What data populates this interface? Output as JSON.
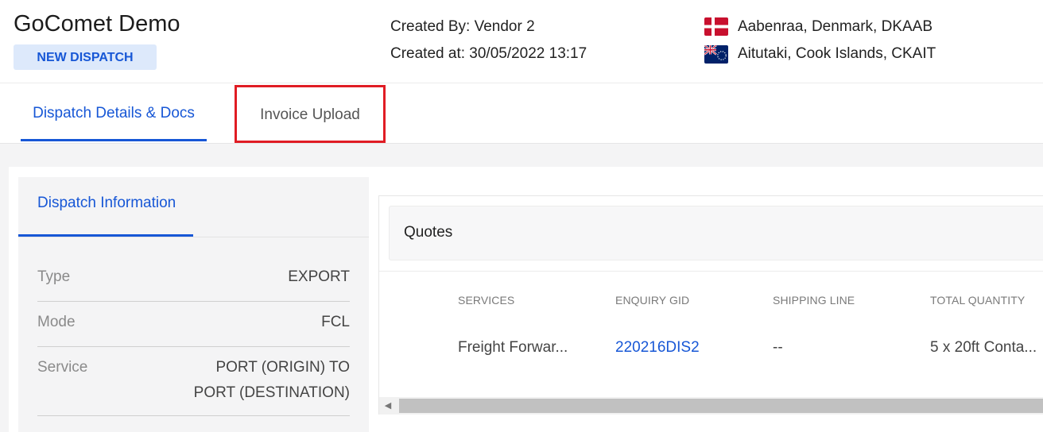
{
  "header": {
    "title": "GoComet Demo",
    "badge": "NEW DISPATCH",
    "created_by": "Created By: Vendor 2",
    "created_at": "Created at: 30/05/2022 13:17",
    "origin": {
      "label": "Aabenraa, Denmark, DKAAB",
      "flag_icon": "denmark-flag-icon"
    },
    "destination": {
      "label": "Aitutaki, Cook Islands, CKAIT",
      "flag_icon": "cook-islands-flag-icon"
    }
  },
  "tabs": [
    {
      "label": "Dispatch Details & Docs",
      "active": true
    },
    {
      "label": "Invoice Upload",
      "active": false,
      "highlighted": true
    }
  ],
  "info": {
    "tab_label": "Dispatch Information",
    "rows": [
      {
        "label": "Type",
        "value": "EXPORT"
      },
      {
        "label": "Mode",
        "value": "FCL"
      },
      {
        "label": "Service",
        "value_line1": "PORT (ORIGIN) TO",
        "value_line2": "PORT (DESTINATION)"
      }
    ]
  },
  "quotes": {
    "title": "Quotes",
    "columns": [
      "SERVICES",
      "ENQUIRY GID",
      "SHIPPING LINE",
      "TOTAL QUANTITY"
    ],
    "rows": [
      {
        "services": "Freight Forwar...",
        "enquiry_gid": "220216DIS2",
        "shipping_line": "--",
        "total_quantity": "5 x 20ft Conta..."
      }
    ]
  },
  "colors": {
    "accent": "#1757d6",
    "highlight_border": "#e01c24",
    "badge_bg": "#dde9fb"
  }
}
